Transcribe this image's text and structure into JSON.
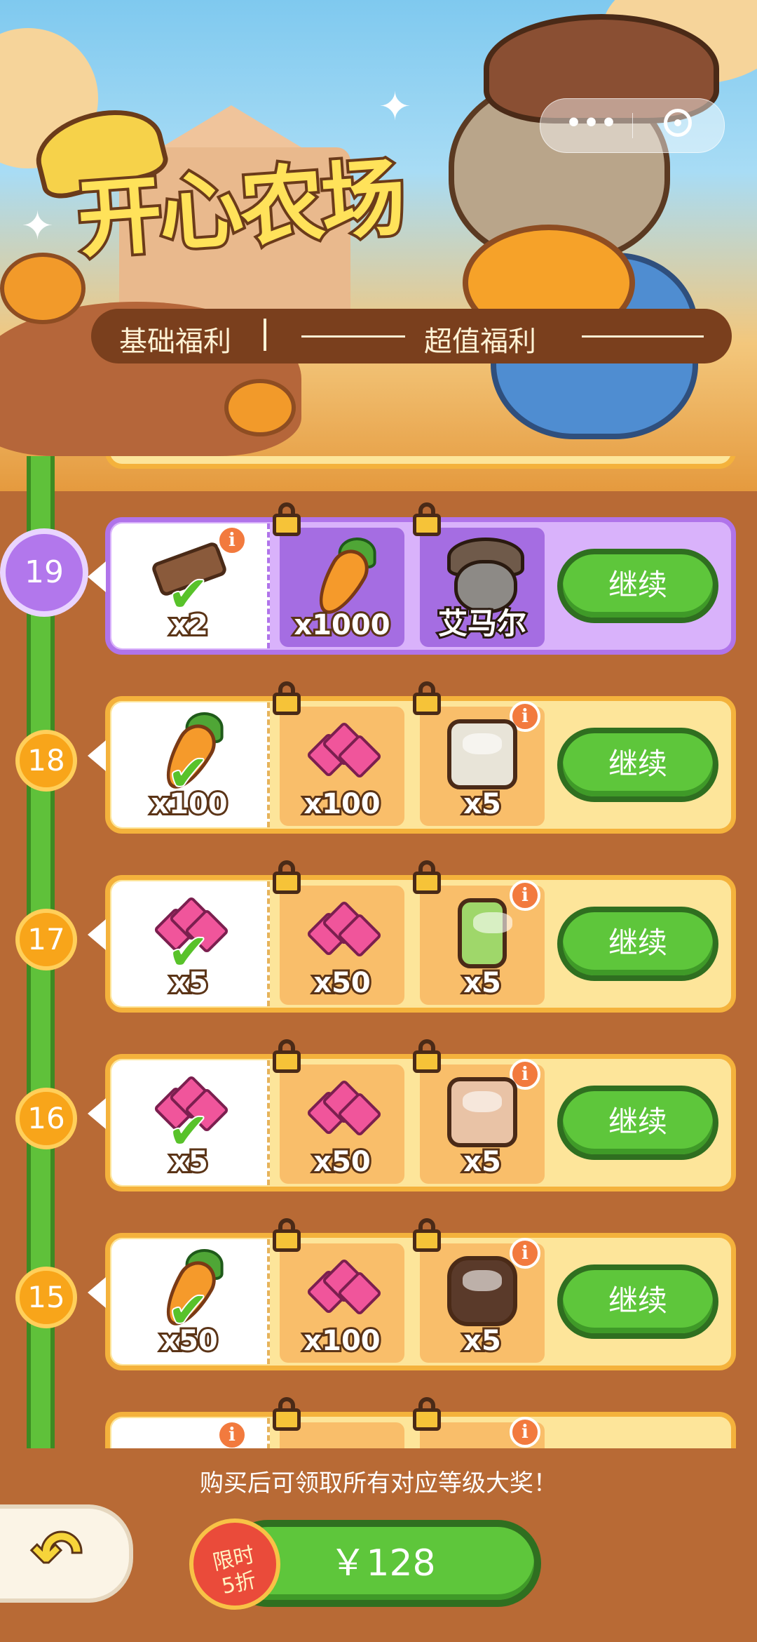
{
  "game": {
    "title": "开心农场"
  },
  "capsule": {
    "more_label": "•••"
  },
  "welfare_bar": {
    "basic_label": "基础福利",
    "super_label": "超值福利"
  },
  "rows": [
    {
      "level": "19",
      "active": true,
      "free": {
        "qty": "x2",
        "icon": "log-icon"
      },
      "paid1": {
        "qty": "x1000",
        "icon": "carrot-icon"
      },
      "paid2": {
        "qty": "艾马尔",
        "icon": "elephant-avatar-icon"
      },
      "button": "继续"
    },
    {
      "level": "18",
      "active": false,
      "free": {
        "qty": "x100",
        "icon": "carrot-icon"
      },
      "paid1": {
        "qty": "x100",
        "icon": "gem-icon"
      },
      "paid2": {
        "qty": "x5",
        "icon": "rice-cooker-icon"
      },
      "button": "继续"
    },
    {
      "level": "17",
      "active": false,
      "free": {
        "qty": "x5",
        "icon": "gem-icon"
      },
      "paid1": {
        "qty": "x50",
        "icon": "gem-icon"
      },
      "paid2": {
        "qty": "x5",
        "icon": "blender-icon"
      },
      "button": "继续"
    },
    {
      "level": "16",
      "active": false,
      "free": {
        "qty": "x5",
        "icon": "gem-icon"
      },
      "paid1": {
        "qty": "x50",
        "icon": "gem-icon"
      },
      "paid2": {
        "qty": "x5",
        "icon": "slow-cooker-icon"
      },
      "button": "继续"
    },
    {
      "level": "15",
      "active": false,
      "free": {
        "qty": "x50",
        "icon": "carrot-icon"
      },
      "paid1": {
        "qty": "x100",
        "icon": "gem-icon"
      },
      "paid2": {
        "qty": "x5",
        "icon": "stew-pot-icon"
      },
      "button": "继续"
    }
  ],
  "footer": {
    "notice": "购买后可领取所有对应等级大奖！",
    "price": "￥128",
    "badge_line1": "限时",
    "badge_line2": "5折"
  },
  "colors": {
    "active_purple": "#b074ea",
    "card_yellow": "#fde59a",
    "button_green": "#5ec63b",
    "track_green": "#5fc13a",
    "background_brown": "#b86a35"
  }
}
